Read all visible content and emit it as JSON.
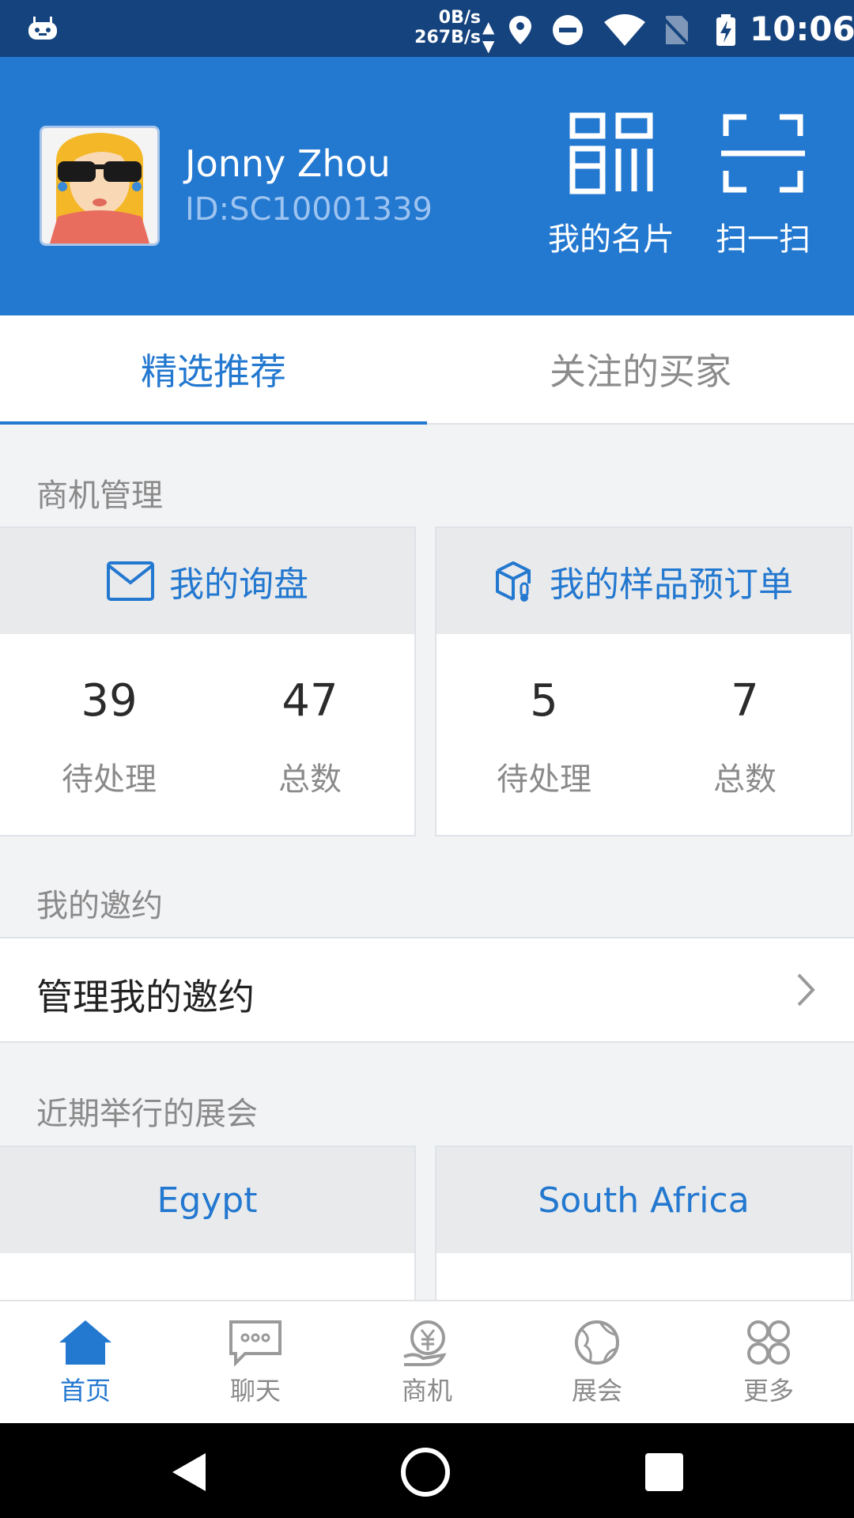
{
  "status_bar": {
    "net_down": "0B/s",
    "net_up": "267B/s",
    "time": "10:06"
  },
  "profile": {
    "name": "Jonny Zhou",
    "id": "ID:SC10001339",
    "card_label": "我的名片",
    "scan_label": "扫一扫"
  },
  "tabs": [
    "精选推荐",
    "关注的买家"
  ],
  "business": {
    "section_title": "商机管理",
    "inquiries": {
      "title": "我的询盘",
      "pending_value": "39",
      "pending_label": "待处理",
      "total_value": "47",
      "total_label": "总数"
    },
    "samples": {
      "title": "我的样品预订单",
      "pending_value": "5",
      "pending_label": "待处理",
      "total_value": "7",
      "total_label": "总数"
    }
  },
  "invitations": {
    "section_title": "我的邀约",
    "manage_label": "管理我的邀约"
  },
  "expos": {
    "section_title": "近期举行的展会",
    "items": [
      "Egypt",
      "South Africa"
    ]
  },
  "bottom_nav": [
    "首页",
    "聊天",
    "商机",
    "展会",
    "更多"
  ],
  "colors": {
    "brand": "#2378d0",
    "status_bar": "#15437e"
  }
}
